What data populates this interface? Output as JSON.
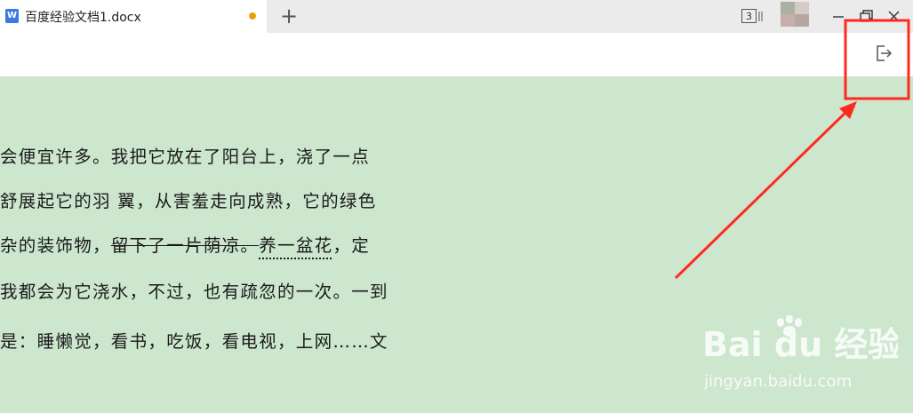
{
  "tab": {
    "title": "百度经验文档1.docx",
    "icon_letter": "W",
    "new_tab_label": "+"
  },
  "window": {
    "window_count": "3"
  },
  "document": {
    "lines": [
      {
        "before": "会便宜许多。我把它放在了阳台上，浇了一点",
        "strike": "",
        "dotted": "",
        "after": ""
      },
      {
        "before": "舒展起它的羽  翼，从害羞走向成熟，它的绿色",
        "strike": "",
        "dotted": "",
        "after": ""
      },
      {
        "before": "杂的装饰物，",
        "strike": "留下了一片荫凉。",
        "dotted": "养一盆花",
        "after": "，定"
      },
      {
        "before": "我都会为它浇水，不过，也有疏忽的一次。一到",
        "strike": "",
        "dotted": "",
        "after": ""
      },
      {
        "before": "是：睡懒觉，看书，吃饭，看电视，上网……文",
        "strike": "",
        "dotted": "",
        "after": ""
      }
    ]
  },
  "watermark": {
    "brand": "Bai du 经验",
    "url": "jingyan.baidu.com"
  },
  "colors": {
    "annotation": "#ff2a1f",
    "tab_dot": "#e8a010",
    "doc_bg": "#cde6ce",
    "wps_blue": "#3a7ae0"
  },
  "icons": {
    "exit": "exit-icon",
    "minimize": "minimize-icon",
    "restore": "restore-icon",
    "close": "close-icon"
  }
}
